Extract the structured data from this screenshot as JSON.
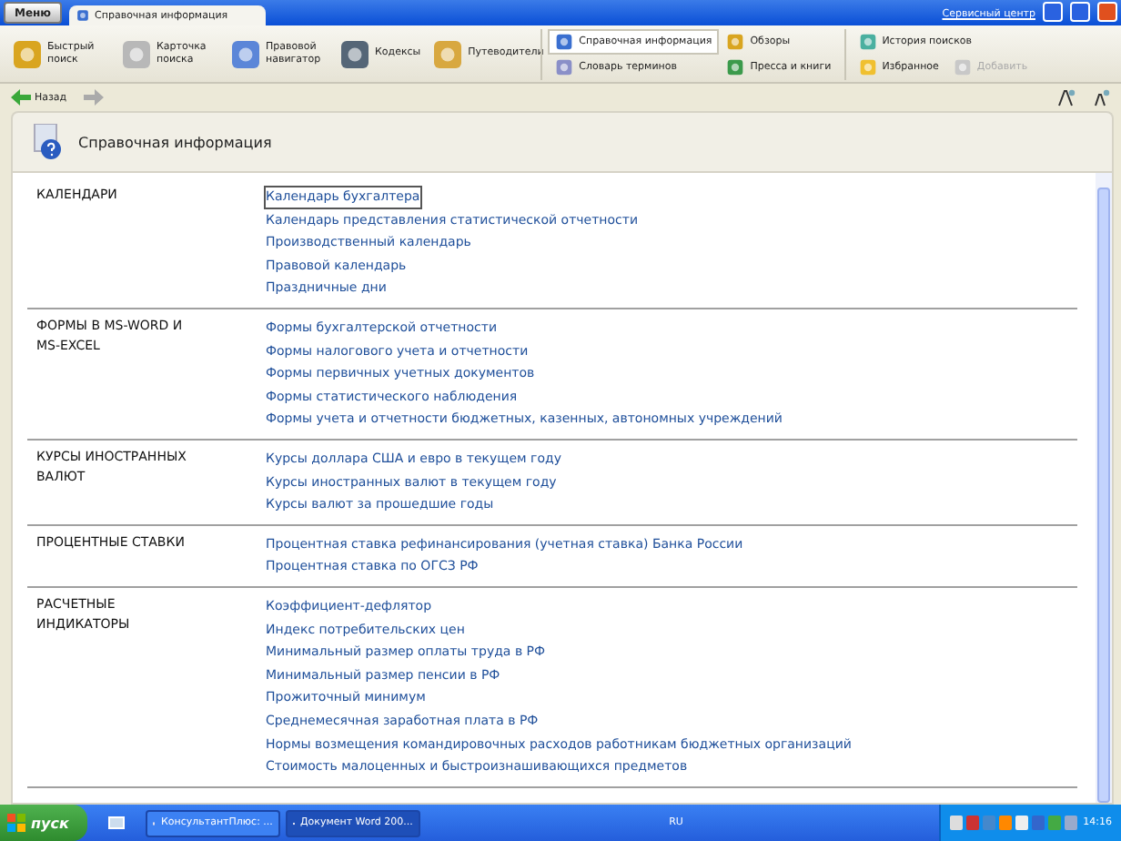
{
  "titlebar": {
    "menu": "Меню",
    "tab": "Справочная информация",
    "service_link": "Сервисный центр"
  },
  "toolbar": {
    "big": [
      {
        "label": "Быстрый поиск"
      },
      {
        "label": "Карточка поиска"
      },
      {
        "label": "Правовой навигатор"
      },
      {
        "label": "Кодексы"
      },
      {
        "label": "Путеводители"
      }
    ],
    "small": [
      {
        "label": "Справочная информация",
        "selected": true,
        "disabled": false
      },
      {
        "label": "Словарь терминов",
        "selected": false,
        "disabled": false
      },
      {
        "label": "Обзоры",
        "selected": false,
        "disabled": false
      },
      {
        "label": "Пресса и книги",
        "selected": false,
        "disabled": false
      },
      {
        "label": "История поисков",
        "selected": false,
        "disabled": false
      },
      {
        "label": "Избранное",
        "selected": false,
        "disabled": false
      },
      {
        "label": "Добавить",
        "selected": false,
        "disabled": true
      }
    ]
  },
  "nav": {
    "back": "Назад"
  },
  "header": {
    "title": "Справочная информация"
  },
  "sections": [
    {
      "title": "КАЛЕНДАРИ",
      "links": [
        {
          "text": "Календарь бухгалтера",
          "focused": true
        },
        {
          "text": "Календарь представления статистической отчетности",
          "focused": false
        },
        {
          "text": "Производственный календарь",
          "focused": false
        },
        {
          "text": "Правовой календарь",
          "focused": false
        },
        {
          "text": "Праздничные дни",
          "focused": false
        }
      ]
    },
    {
      "title": "ФОРМЫ В MS-WORD И MS-EXCEL",
      "links": [
        {
          "text": "Формы бухгалтерской отчетности",
          "focused": false
        },
        {
          "text": "Формы налогового учета и отчетности",
          "focused": false
        },
        {
          "text": "Формы первичных учетных документов",
          "focused": false
        },
        {
          "text": "Формы статистического наблюдения",
          "focused": false
        },
        {
          "text": "Формы учета и отчетности бюджетных, казенных, автономных учреждений",
          "focused": false
        }
      ]
    },
    {
      "title": "КУРСЫ ИНОСТРАННЫХ ВАЛЮТ",
      "links": [
        {
          "text": "Курсы доллара США и евро в текущем году",
          "focused": false
        },
        {
          "text": "Курсы иностранных валют в текущем году",
          "focused": false
        },
        {
          "text": "Курсы валют за прошедшие годы",
          "focused": false
        }
      ]
    },
    {
      "title": "ПРОЦЕНТНЫЕ СТАВКИ",
      "links": [
        {
          "text": "Процентная ставка рефинансирования (учетная ставка) Банка России",
          "focused": false
        },
        {
          "text": "Процентная ставка по ОГСЗ РФ",
          "focused": false
        }
      ]
    },
    {
      "title": "РАСЧЕТНЫЕ ИНДИКАТОРЫ",
      "links": [
        {
          "text": "Коэффициент-дефлятор",
          "focused": false
        },
        {
          "text": "Индекс потребительских цен",
          "focused": false
        },
        {
          "text": "Минимальный размер оплаты труда в РФ",
          "focused": false
        },
        {
          "text": "Минимальный размер пенсии в РФ",
          "focused": false
        },
        {
          "text": "Прожиточный минимум",
          "focused": false
        },
        {
          "text": "Среднемесячная заработная плата в РФ",
          "focused": false
        },
        {
          "text": "Нормы возмещения командировочных расходов работникам бюджетных организаций",
          "focused": false
        },
        {
          "text": "Стоимость малоценных и быстроизнашивающихся предметов",
          "focused": false
        }
      ]
    }
  ],
  "taskbar": {
    "start": "пуск",
    "tasks": [
      {
        "label": "КонсультантПлюс: ...",
        "selected": false
      },
      {
        "label": "Документ Word 200...",
        "selected": true
      }
    ],
    "lang": "RU",
    "time": "14:16"
  }
}
